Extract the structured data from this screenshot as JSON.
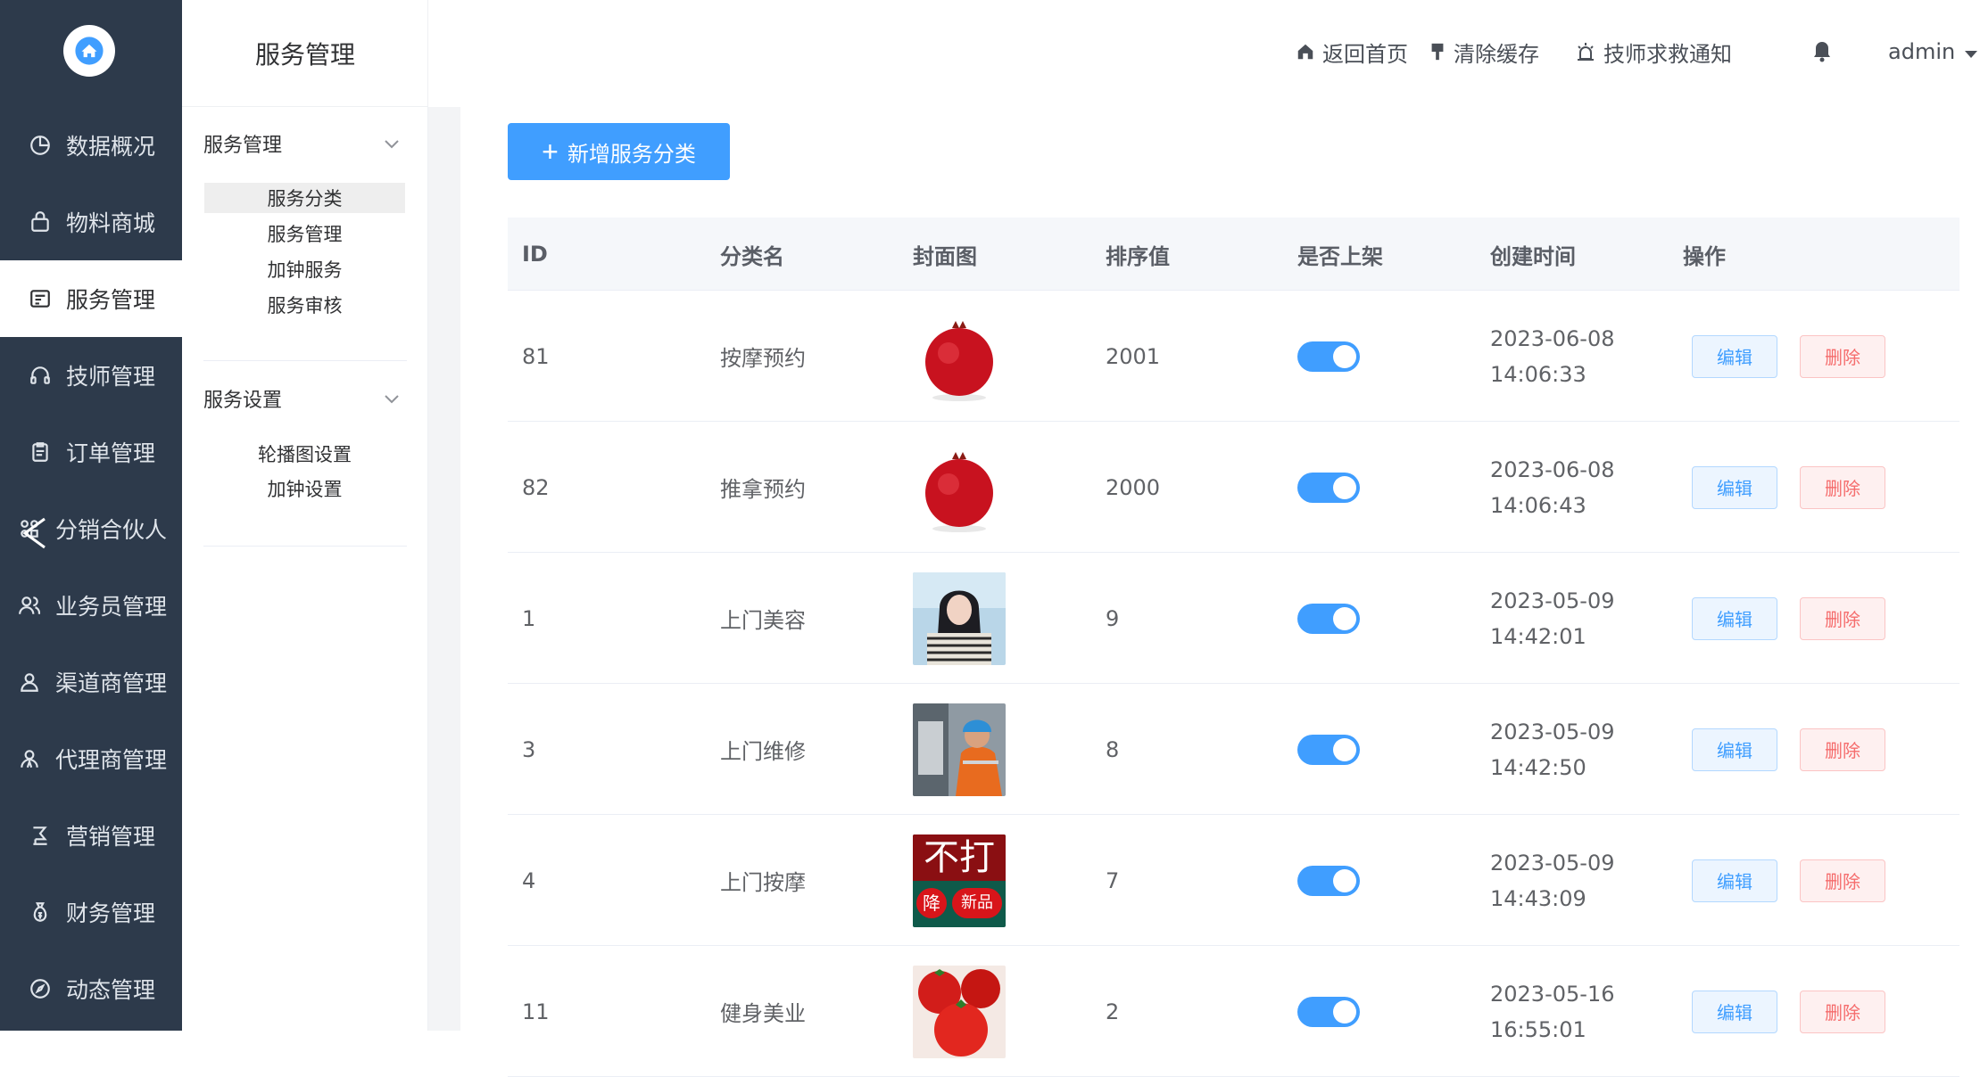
{
  "sidebar": {
    "items": [
      {
        "label": "数据概况",
        "icon": "pie-chart-icon"
      },
      {
        "label": "物料商城",
        "icon": "bag-icon"
      },
      {
        "label": "服务管理",
        "icon": "service-icon",
        "active": true
      },
      {
        "label": "技师管理",
        "icon": "headset-icon"
      },
      {
        "label": "订单管理",
        "icon": "clipboard-icon"
      },
      {
        "label": "分销合伙人",
        "icon": "share-icon"
      },
      {
        "label": "业务员管理",
        "icon": "users-icon"
      },
      {
        "label": "渠道商管理",
        "icon": "user-icon"
      },
      {
        "label": "代理商管理",
        "icon": "agent-icon"
      },
      {
        "label": "营销管理",
        "icon": "marketing-icon"
      },
      {
        "label": "财务管理",
        "icon": "money-bag-icon"
      },
      {
        "label": "动态管理",
        "icon": "compass-icon"
      }
    ]
  },
  "submenu": {
    "title": "服务管理",
    "groups": [
      {
        "label": "服务管理",
        "items": [
          "服务分类",
          "服务管理",
          "加钟服务",
          "服务审核"
        ]
      },
      {
        "label": "服务设置",
        "items": [
          "轮播图设置",
          "加钟设置"
        ]
      }
    ]
  },
  "header": {
    "home": "返回首页",
    "clear_cache": "清除缓存",
    "rescue_notice": "技师求救通知",
    "user": "admin"
  },
  "main": {
    "add_button": "新增服务分类",
    "table": {
      "columns": [
        "ID",
        "分类名",
        "封面图",
        "排序值",
        "是否上架",
        "创建时间",
        "操作"
      ],
      "edit_label": "编辑",
      "delete_label": "删除",
      "rows": [
        {
          "id": "81",
          "name": "按摩预约",
          "cover": "pomegranate",
          "sort": "2001",
          "on_shelf": true,
          "date": "2023-06-08",
          "time": "14:06:33"
        },
        {
          "id": "82",
          "name": "推拿预约",
          "cover": "pomegranate",
          "sort": "2000",
          "on_shelf": true,
          "date": "2023-06-08",
          "time": "14:06:43"
        },
        {
          "id": "1",
          "name": "上门美容",
          "cover": "woman-portrait",
          "sort": "9",
          "on_shelf": true,
          "date": "2023-05-09",
          "time": "14:42:01"
        },
        {
          "id": "3",
          "name": "上门维修",
          "cover": "repair-worker",
          "sort": "8",
          "on_shelf": true,
          "date": "2023-05-09",
          "time": "14:42:50"
        },
        {
          "id": "4",
          "name": "上门按摩",
          "cover": "promo-banner",
          "sort": "7",
          "on_shelf": true,
          "date": "2023-05-09",
          "time": "14:43:09"
        },
        {
          "id": "11",
          "name": "健身美业",
          "cover": "tomatoes",
          "sort": "2",
          "on_shelf": true,
          "date": "2023-05-16",
          "time": "16:55:01"
        }
      ],
      "promo_banner_text": {
        "top": "不打",
        "left": "降",
        "right": "新品"
      }
    }
  },
  "colors": {
    "sidebar_bg": "#2d3a4b",
    "primary": "#409eff",
    "danger": "#f56c6c"
  }
}
